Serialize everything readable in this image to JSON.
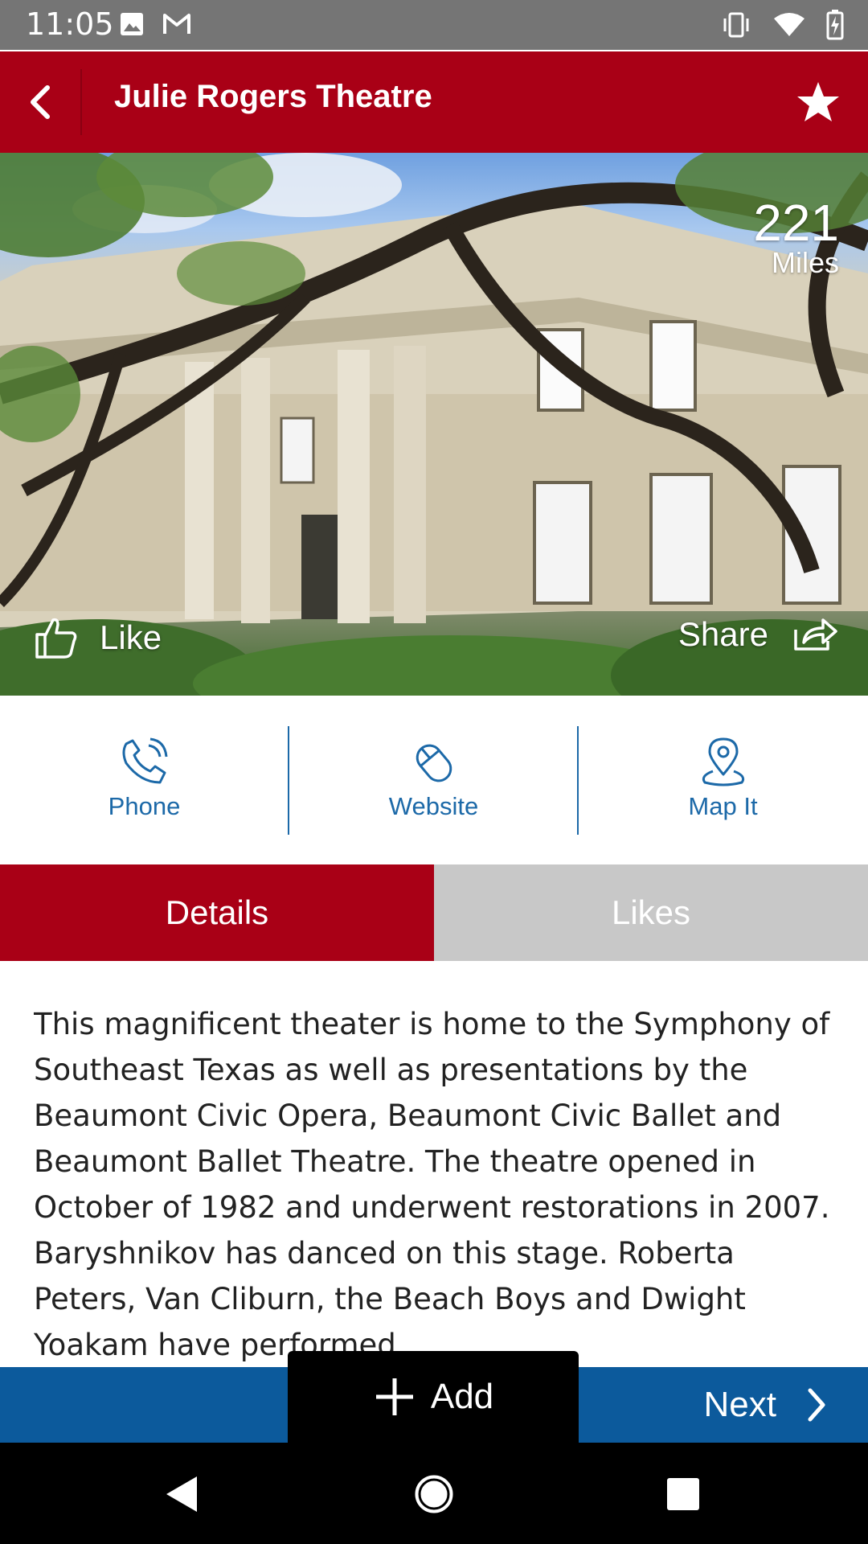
{
  "status_bar": {
    "time": "11:05",
    "left_icons": [
      "image-icon",
      "gmail-icon"
    ],
    "right_icons": [
      "vibrate-icon",
      "wifi-icon",
      "battery-charging-icon"
    ]
  },
  "app_bar": {
    "title": "Julie Rogers Theatre",
    "back_icon": "chevron-left-icon",
    "favorite_icon": "star-icon",
    "color": "#a90016"
  },
  "hero": {
    "distance_value": "221",
    "distance_unit": "Miles",
    "like_label": "Like",
    "share_label": "Share"
  },
  "actions": [
    {
      "label": "Phone",
      "icon": "phone-icon"
    },
    {
      "label": "Website",
      "icon": "mouse-icon"
    },
    {
      "label": "Map It",
      "icon": "map-pin-icon"
    }
  ],
  "tabs": [
    {
      "label": "Details",
      "active": true
    },
    {
      "label": "Likes",
      "active": false
    }
  ],
  "description": "This magnificent theater is home to the Symphony of Southeast Texas as well as presentations by the Beaumont Civic Opera, Beaumont Civic Ballet and Beaumont Ballet Theatre. The theatre opened in October of 1982 and underwent restorations in 2007. Baryshnikov has danced on this stage. Roberta Peters, Van Cliburn, the Beach Boys and Dwight Yoakam have performed",
  "bottom_bar": {
    "add_label": "Add",
    "next_label": "Next",
    "color": "#0c5a9c"
  },
  "nav_bar": [
    "back-triangle-icon",
    "home-circle-icon",
    "recents-square-icon"
  ]
}
